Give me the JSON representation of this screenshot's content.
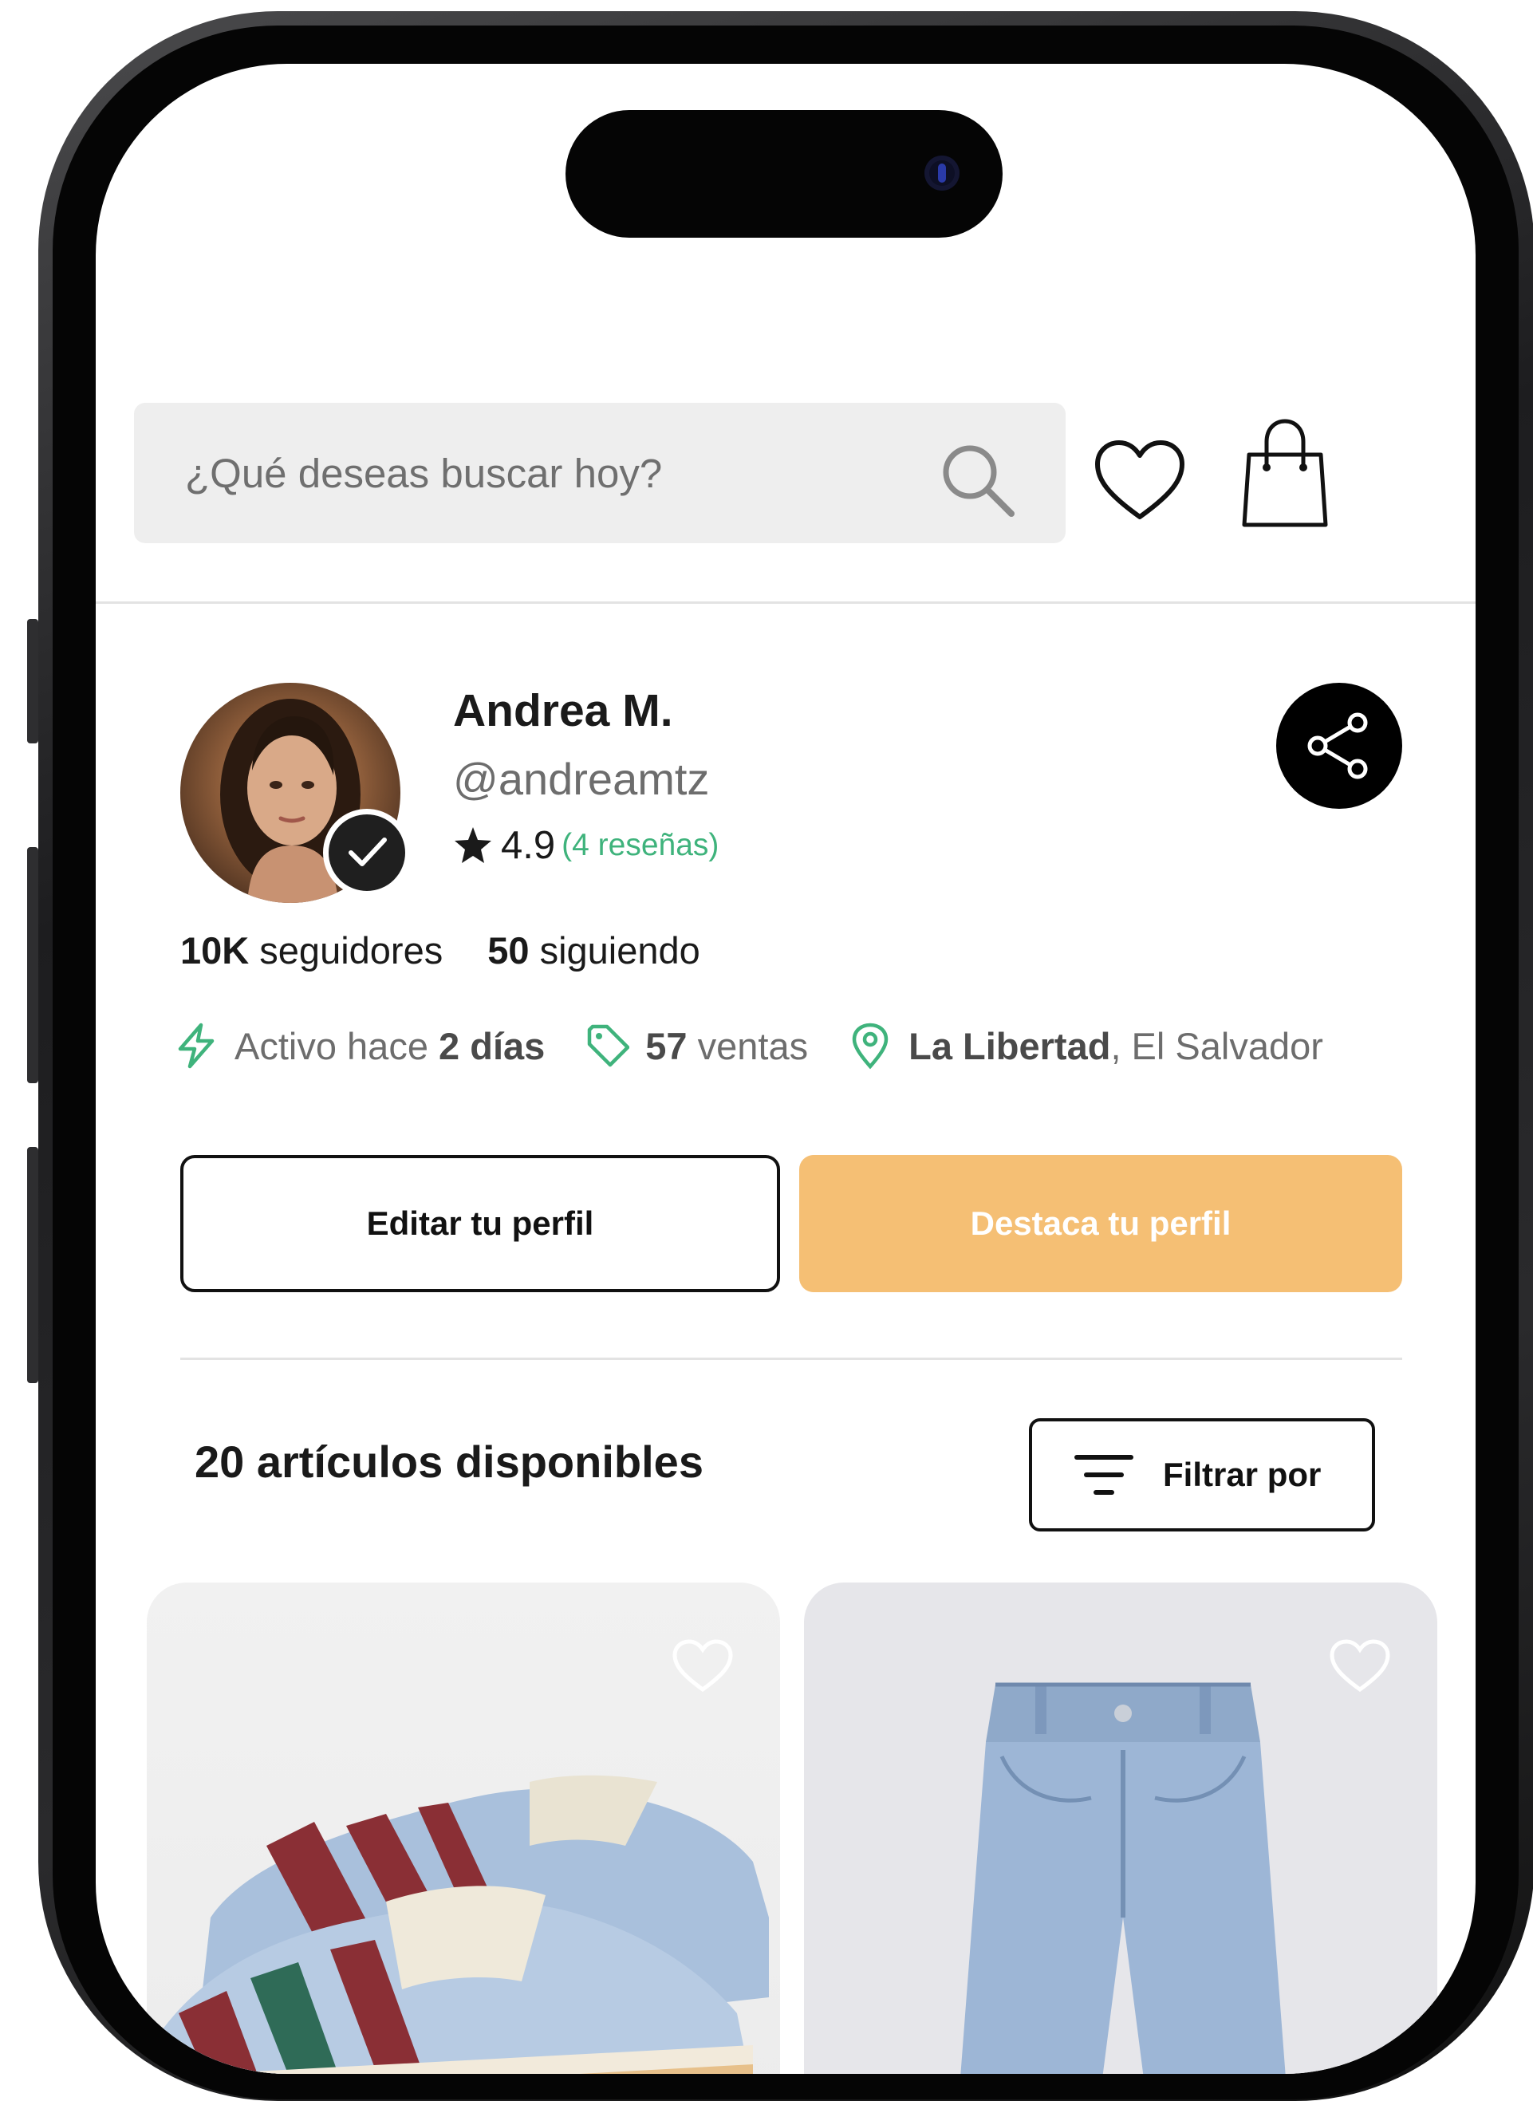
{
  "search": {
    "placeholder": "¿Qué deseas buscar hoy?"
  },
  "header_icons": [
    "search-icon",
    "heart-icon",
    "shopping-bag-icon"
  ],
  "profile": {
    "name": "Andrea M.",
    "handle": "@andreamtz",
    "rating": "4.9",
    "reviews": "(4 reseñas)",
    "verified": true,
    "followers_count": "10K",
    "followers_label": "seguidores",
    "following_count": "50",
    "following_label": "siguiendo",
    "active_prefix": "Activo hace",
    "active_value": "2 días",
    "sales_count": "57",
    "sales_label": "ventas",
    "location_city": "La Libertad",
    "location_country": ", El Salvador"
  },
  "actions": {
    "edit_label": "Editar tu perfil",
    "feature_label": "Destaca tu perfil"
  },
  "listing": {
    "count_title": "20 artículos disponibles",
    "filter_label": "Filtrar por",
    "products": [
      {
        "kind": "sneakers",
        "favorited": false
      },
      {
        "kind": "jeans",
        "favorited": false
      }
    ]
  },
  "colors": {
    "accent_orange": "#f5bf74",
    "accent_green": "#3fb37c",
    "text_dark": "#1a1a1a",
    "text_muted": "#6d6d6d"
  }
}
